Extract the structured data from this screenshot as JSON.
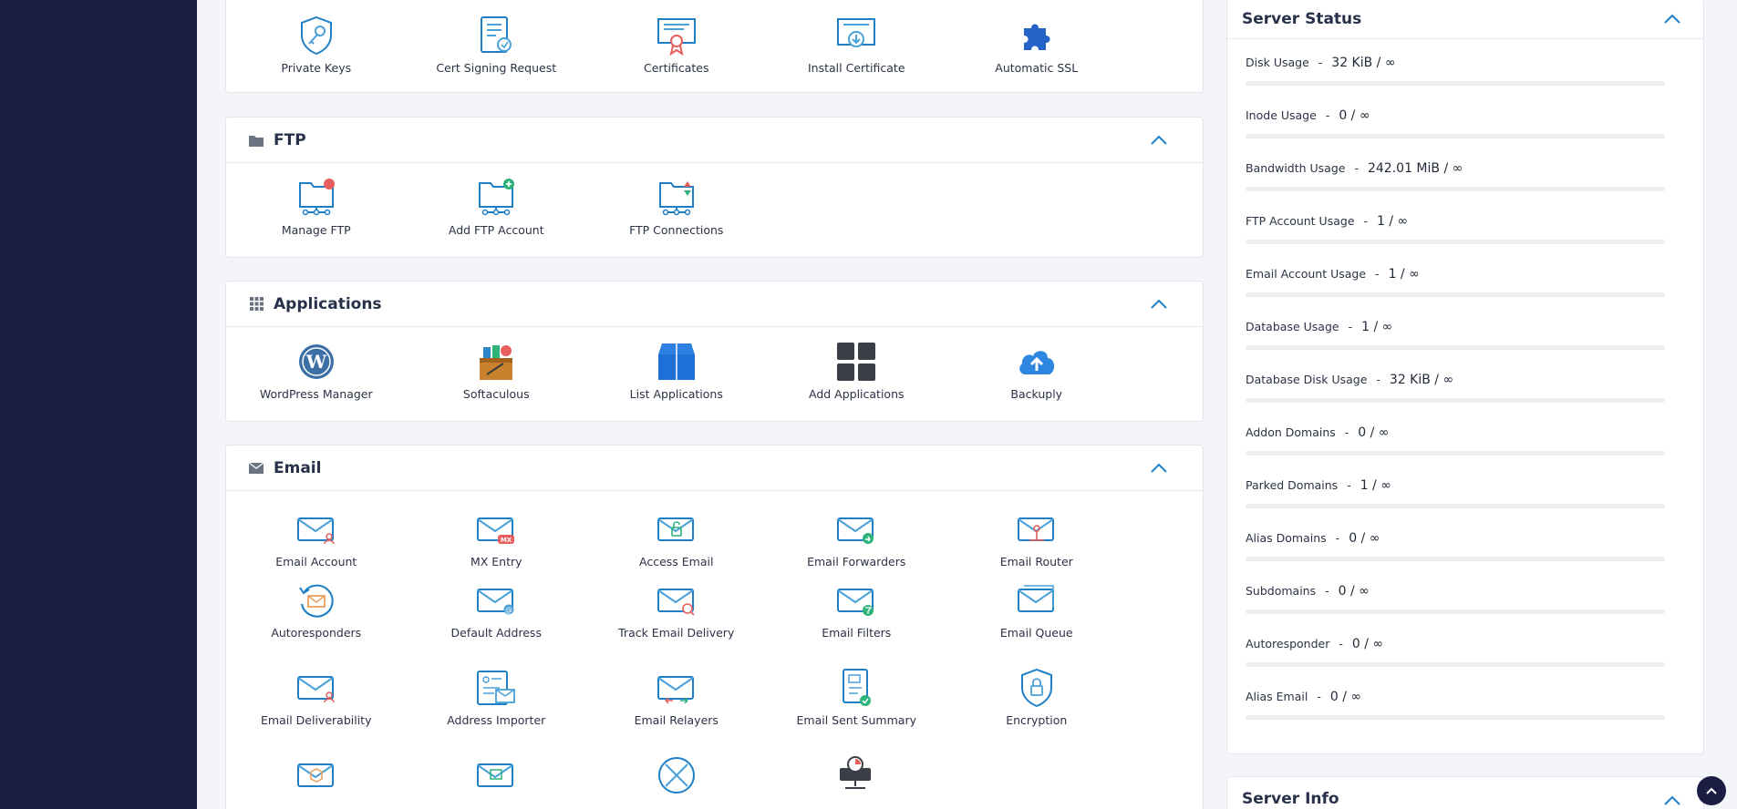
{
  "ssl": {
    "tiles": [
      {
        "label": "Private Keys",
        "icon": "shield-key-icon"
      },
      {
        "label": "Cert Signing Request",
        "icon": "cert-request-icon"
      },
      {
        "label": "Certificates",
        "icon": "certificate-icon"
      },
      {
        "label": "Install Certificate",
        "icon": "install-certificate-icon"
      },
      {
        "label": "Automatic SSL",
        "icon": "puzzle-icon"
      }
    ]
  },
  "ftp": {
    "title": "FTP",
    "tiles": [
      {
        "label": "Manage FTP",
        "icon": "ftp-manage-icon"
      },
      {
        "label": "Add FTP Account",
        "icon": "ftp-add-icon"
      },
      {
        "label": "FTP Connections",
        "icon": "ftp-connections-icon"
      }
    ]
  },
  "applications": {
    "title": "Applications",
    "tiles": [
      {
        "label": "WordPress Manager",
        "icon": "wordpress-icon"
      },
      {
        "label": "Softaculous",
        "icon": "softaculous-icon"
      },
      {
        "label": "List Applications",
        "icon": "box-icon"
      },
      {
        "label": "Add Applications",
        "icon": "grid-icon"
      },
      {
        "label": "Backuply",
        "icon": "cloud-upload-icon"
      }
    ]
  },
  "email": {
    "title": "Email",
    "tiles": [
      {
        "label": "Email Account",
        "icon": "email-account-icon"
      },
      {
        "label": "MX Entry",
        "icon": "mx-entry-icon"
      },
      {
        "label": "Access Email",
        "icon": "access-email-icon"
      },
      {
        "label": "Email Forwarders",
        "icon": "email-forwarders-icon"
      },
      {
        "label": "Email Router",
        "icon": "email-router-icon"
      },
      {
        "label": "Autoresponders",
        "icon": "autoresponders-icon"
      },
      {
        "label": "Default Address",
        "icon": "default-address-icon"
      },
      {
        "label": "Track Email Delivery",
        "icon": "track-email-icon"
      },
      {
        "label": "Email Filters",
        "icon": "email-filters-icon"
      },
      {
        "label": "Email Queue",
        "icon": "email-queue-icon"
      },
      {
        "label": "Email Deliverability",
        "icon": "email-deliverability-icon"
      },
      {
        "label": "Address Importer",
        "icon": "address-importer-icon"
      },
      {
        "label": "Email Relayers",
        "icon": "email-relayers-icon"
      },
      {
        "label": "Email Sent Summary",
        "icon": "email-sent-summary-icon"
      },
      {
        "label": "Encryption",
        "icon": "encryption-icon"
      }
    ]
  },
  "server_status": {
    "title": "Server Status",
    "stats": [
      {
        "label": "Disk Usage",
        "value": "32 KiB / ∞",
        "fill": 0
      },
      {
        "label": "Inode Usage",
        "value": "0 / ∞",
        "fill": 0
      },
      {
        "label": "Bandwidth Usage",
        "value": "242.01 MiB / ∞",
        "fill": 0
      },
      {
        "label": "FTP Account Usage",
        "value": "1 / ∞",
        "fill": 0
      },
      {
        "label": "Email Account Usage",
        "value": "1 / ∞",
        "fill": 0
      },
      {
        "label": "Database Usage",
        "value": "1 / ∞",
        "fill": 0
      },
      {
        "label": "Database Disk Usage",
        "value": "32 KiB / ∞",
        "fill": 0
      },
      {
        "label": "Addon Domains",
        "value": "0 / ∞",
        "fill": 0
      },
      {
        "label": "Parked Domains",
        "value": "1 / ∞",
        "fill": 0
      },
      {
        "label": "Alias Domains",
        "value": "0 / ∞",
        "fill": 0
      },
      {
        "label": "Subdomains",
        "value": "0 / ∞",
        "fill": 0
      },
      {
        "label": "Autoresponder",
        "value": "0 / ∞",
        "fill": 0
      },
      {
        "label": "Alias Email",
        "value": "0 / ∞",
        "fill": 0
      }
    ]
  },
  "server_info": {
    "title": "Server Info"
  },
  "colors": {
    "sidebar": "#1b1e42",
    "icon_blue": "#1f7fc4",
    "accent_red": "#e85d5d",
    "accent_green": "#2db37a"
  }
}
